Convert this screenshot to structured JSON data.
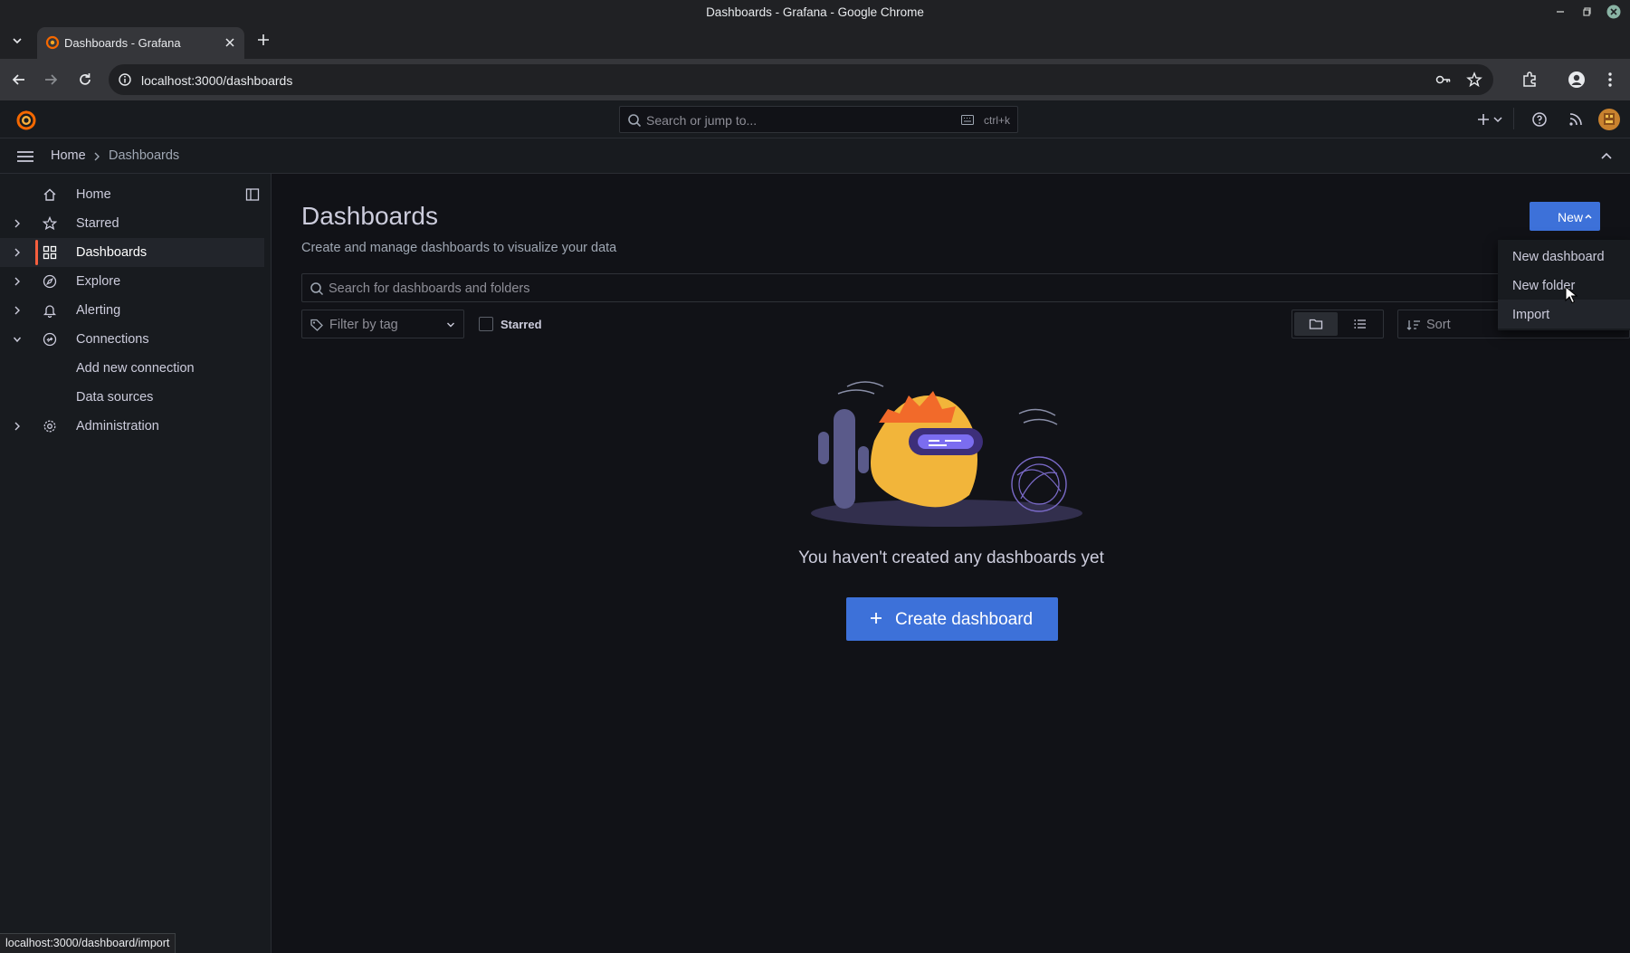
{
  "window": {
    "title": "Dashboards - Grafana - Google Chrome"
  },
  "browser": {
    "tab_title": "Dashboards - Grafana",
    "url": "localhost:3000/dashboards",
    "status_url": "localhost:3000/dashboard/import"
  },
  "topbar": {
    "search_placeholder": "Search or jump to...",
    "search_shortcut": "ctrl+k"
  },
  "breadcrumb": {
    "items": [
      "Home",
      "Dashboards"
    ]
  },
  "sidebar": {
    "items": [
      {
        "label": "Home",
        "icon": "home-icon"
      },
      {
        "label": "Starred",
        "icon": "star-icon"
      },
      {
        "label": "Dashboards",
        "icon": "apps-grid-icon",
        "active": true
      },
      {
        "label": "Explore",
        "icon": "compass-icon"
      },
      {
        "label": "Alerting",
        "icon": "bell-icon"
      },
      {
        "label": "Connections",
        "icon": "connections-icon",
        "expanded": true
      },
      {
        "label": "Add new connection"
      },
      {
        "label": "Data sources"
      },
      {
        "label": "Administration",
        "icon": "cog-icon"
      }
    ]
  },
  "main": {
    "title": "Dashboards",
    "subtitle": "Create and manage dashboards to visualize your data",
    "new_button": "New",
    "search_placeholder": "Search for dashboards and folders",
    "tag_filter_placeholder": "Filter by tag",
    "starred_label": "Starred",
    "sort_placeholder": "Sort",
    "empty_message": "You haven't created any dashboards yet",
    "create_button": "Create dashboard"
  },
  "new_menu": {
    "items": [
      "New dashboard",
      "New folder",
      "Import"
    ],
    "hovered": "Import"
  },
  "colors": {
    "accent": "#3d71d9",
    "active_nav": "#f55f3e",
    "background": "#111217"
  }
}
